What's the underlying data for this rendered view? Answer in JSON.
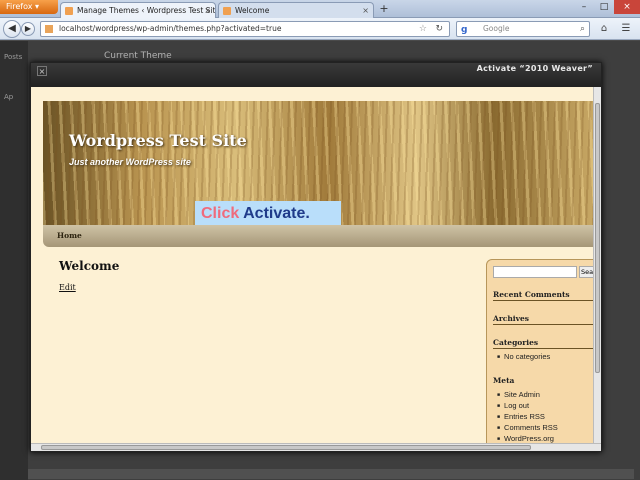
{
  "browser": {
    "menu_button": "Firefox",
    "tabs": [
      {
        "label": "Manage Themes ‹ Wordpress Test Sit..."
      },
      {
        "label": "Welcome"
      }
    ],
    "url": "localhost/wordpress/wp-admin/themes.php?activated=true",
    "search_placeholder": "Google"
  },
  "admin": {
    "heading": "Current Theme",
    "sidebar_items": [
      "Posts",
      "Ap"
    ]
  },
  "modal": {
    "title": "Activate “2010 Weaver”"
  },
  "preview": {
    "site_title": "Wordpress Test Site",
    "site_description": "Just another WordPress site",
    "callout_click": "Click",
    "callout_activate": "Activate",
    "callout_period": ".",
    "menu_home": "Home",
    "post_title": "Welcome",
    "post_edit": "Edit",
    "sidebar": {
      "search_button": "Search",
      "recent_comments": "Recent Comments",
      "archives": "Archives",
      "categories": "Categories",
      "categories_items": [
        "No categories"
      ],
      "meta": "Meta",
      "meta_items": [
        "Site Admin",
        "Log out",
        "Entries RSS",
        "Comments RSS",
        "WordPress.org"
      ]
    }
  }
}
